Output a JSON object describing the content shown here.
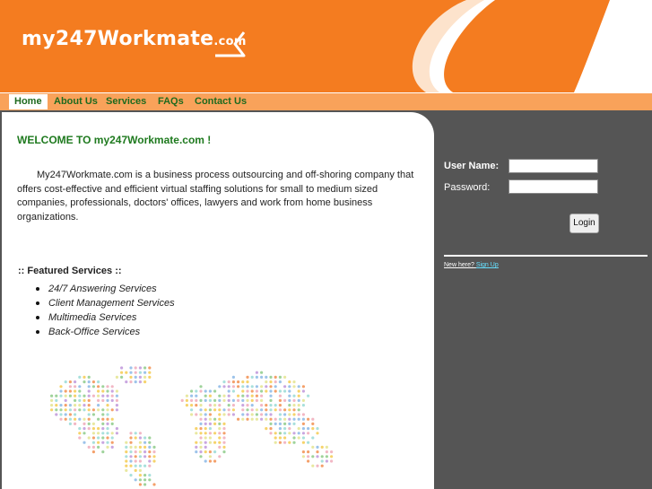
{
  "logo": {
    "main": "my247Workmate",
    "suffix": ".com"
  },
  "nav": [
    {
      "label": "Home",
      "active": true
    },
    {
      "label": "About Us",
      "active": false
    },
    {
      "label": "Services",
      "active": false
    },
    {
      "label": "FAQs",
      "active": false
    },
    {
      "label": "Contact Us",
      "active": false
    }
  ],
  "content": {
    "welcome": "WELCOME TO my247Workmate.com !",
    "intro": "My247Workmate.com is a business process outsourcing and off-shoring company that offers cost-effective and efficient virtual staffing solutions for small to medium sized companies, professionals, doctors' offices, lawyers and work from home business organizations.",
    "featured_title": ":: Featured Services ::",
    "services": [
      "24/7 Answering Services",
      "Client Management Services",
      "Multimedia Services",
      "Back-Office Services"
    ]
  },
  "login": {
    "username_label": "User Name:",
    "password_label": "Password:",
    "username_value": "",
    "password_value": "",
    "button_label": "Login",
    "new_here": "New here?",
    "signup": "Sign Up"
  },
  "colors": {
    "orange": "#f47c20",
    "nav_bg": "#f9a25a",
    "green": "#1f7a1f",
    "panel": "#555555"
  }
}
